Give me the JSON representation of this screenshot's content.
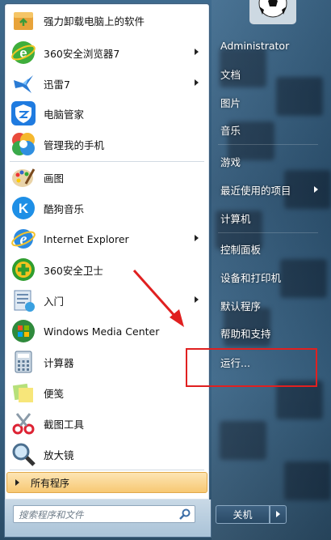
{
  "programs": [
    {
      "label": "强力卸载电脑上的软件",
      "icon": "uninstall-box-icon",
      "has_submenu": false
    },
    {
      "label": "360安全浏览器7",
      "icon": "360-browser-icon",
      "has_submenu": true
    },
    {
      "label": "迅雷7",
      "icon": "thunder-bird-icon",
      "has_submenu": true
    },
    {
      "label": "电脑管家",
      "icon": "pc-manager-shield-icon",
      "has_submenu": false
    },
    {
      "label": "管理我的手机",
      "icon": "phone-manager-icon",
      "has_submenu": false
    },
    {
      "label": "画图",
      "icon": "paint-palette-icon",
      "has_submenu": false
    },
    {
      "label": "酷狗音乐",
      "icon": "kugou-music-icon",
      "has_submenu": false
    },
    {
      "label": "Internet Explorer",
      "icon": "internet-explorer-icon",
      "has_submenu": true
    },
    {
      "label": "360安全卫士",
      "icon": "360-security-guard-icon",
      "has_submenu": false
    },
    {
      "label": "入门",
      "icon": "getting-started-icon",
      "has_submenu": true
    },
    {
      "label": "Windows Media Center",
      "icon": "windows-media-center-icon",
      "has_submenu": false
    },
    {
      "label": "计算器",
      "icon": "calculator-icon",
      "has_submenu": false
    },
    {
      "label": "便笺",
      "icon": "sticky-notes-icon",
      "has_submenu": false
    },
    {
      "label": "截图工具",
      "icon": "snipping-tool-icon",
      "has_submenu": false
    },
    {
      "label": "放大镜",
      "icon": "magnifier-icon",
      "has_submenu": false
    }
  ],
  "all_programs": "所有程序",
  "search": {
    "placeholder": "搜索程序和文件"
  },
  "right_menu": [
    {
      "label": "Administrator",
      "has_submenu": false
    },
    {
      "label": "文档",
      "has_submenu": false
    },
    {
      "label": "图片",
      "has_submenu": false
    },
    {
      "label": "音乐",
      "has_submenu": false
    },
    {
      "label": "游戏",
      "has_submenu": false
    },
    {
      "label": "最近使用的项目",
      "has_submenu": true
    },
    {
      "label": "计算机",
      "has_submenu": false
    },
    {
      "label": "控制面板",
      "has_submenu": false
    },
    {
      "label": "设备和打印机",
      "has_submenu": false
    },
    {
      "label": "默认程序",
      "has_submenu": false
    },
    {
      "label": "帮助和支持",
      "has_submenu": false
    },
    {
      "label": "运行...",
      "has_submenu": false
    }
  ],
  "shutdown_label": "关机",
  "colors": {
    "annotation": "#e02020",
    "all_programs_bg": "#f7c873",
    "menu_text_right": "#ffffff"
  }
}
